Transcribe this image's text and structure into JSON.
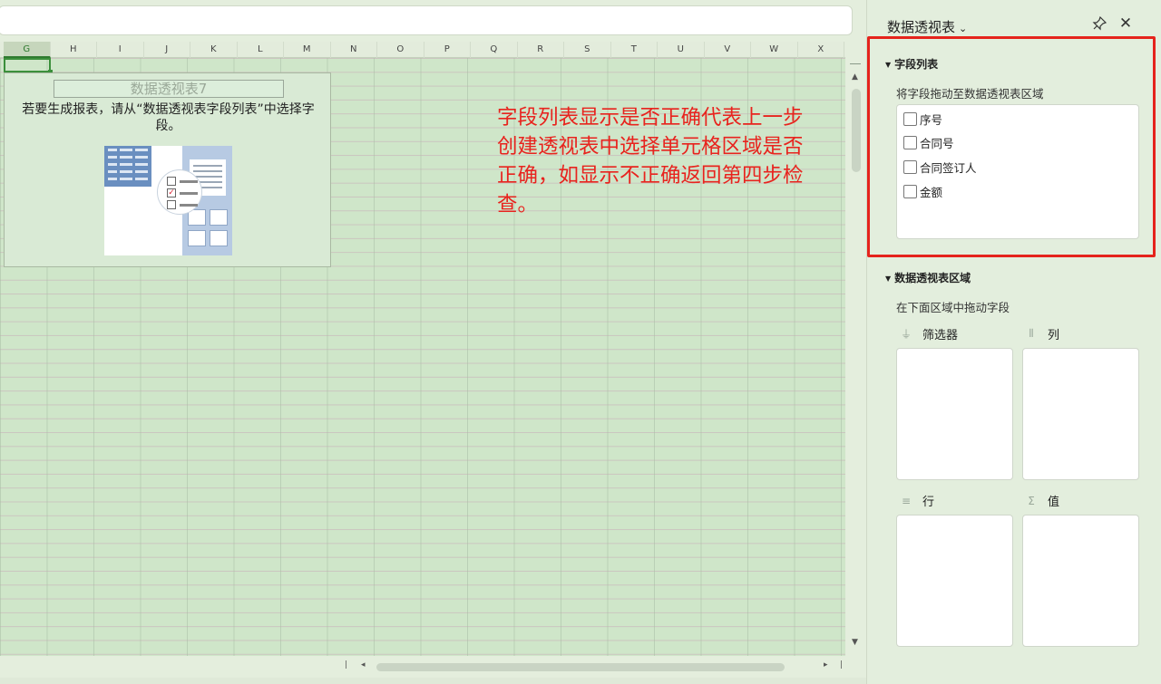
{
  "columns": [
    "G",
    "H",
    "I",
    "J",
    "K",
    "L",
    "M",
    "N",
    "O",
    "P",
    "Q",
    "R",
    "S",
    "T",
    "U",
    "V",
    "W",
    "X"
  ],
  "active_column": "G",
  "pivot_placeholder": {
    "title": "数据透视表7",
    "message": "若要生成报表，请从“数据透视表字段列表”中选择字段。"
  },
  "annotation": "字段列表显示是否正确代表上一步创建透视表中选择单元格区域是否正确，如显示不正确返回第四步检查。",
  "panel": {
    "title": "数据透视表",
    "field_section": {
      "title": "字段列表",
      "subtitle": "将字段拖动至数据透视表区域",
      "fields": [
        "序号",
        "合同号",
        "合同签订人",
        "金额"
      ]
    },
    "area_section": {
      "title": "数据透视表区域",
      "subtitle": "在下面区域中拖动字段",
      "areas": {
        "filter": "筛选器",
        "columns": "列",
        "rows": "行",
        "values": "值"
      }
    }
  },
  "icons": {
    "pin": "pin-icon",
    "close": "close-icon",
    "dropdown": "chevron-down-icon",
    "filter": "filter-icon",
    "columns": "columns-icon",
    "rows": "rows-icon",
    "values": "sigma-icon"
  },
  "colors": {
    "annotation": "#e8231e",
    "highlight_box": "#e5231c",
    "active_cell": "#3b8f3b"
  }
}
